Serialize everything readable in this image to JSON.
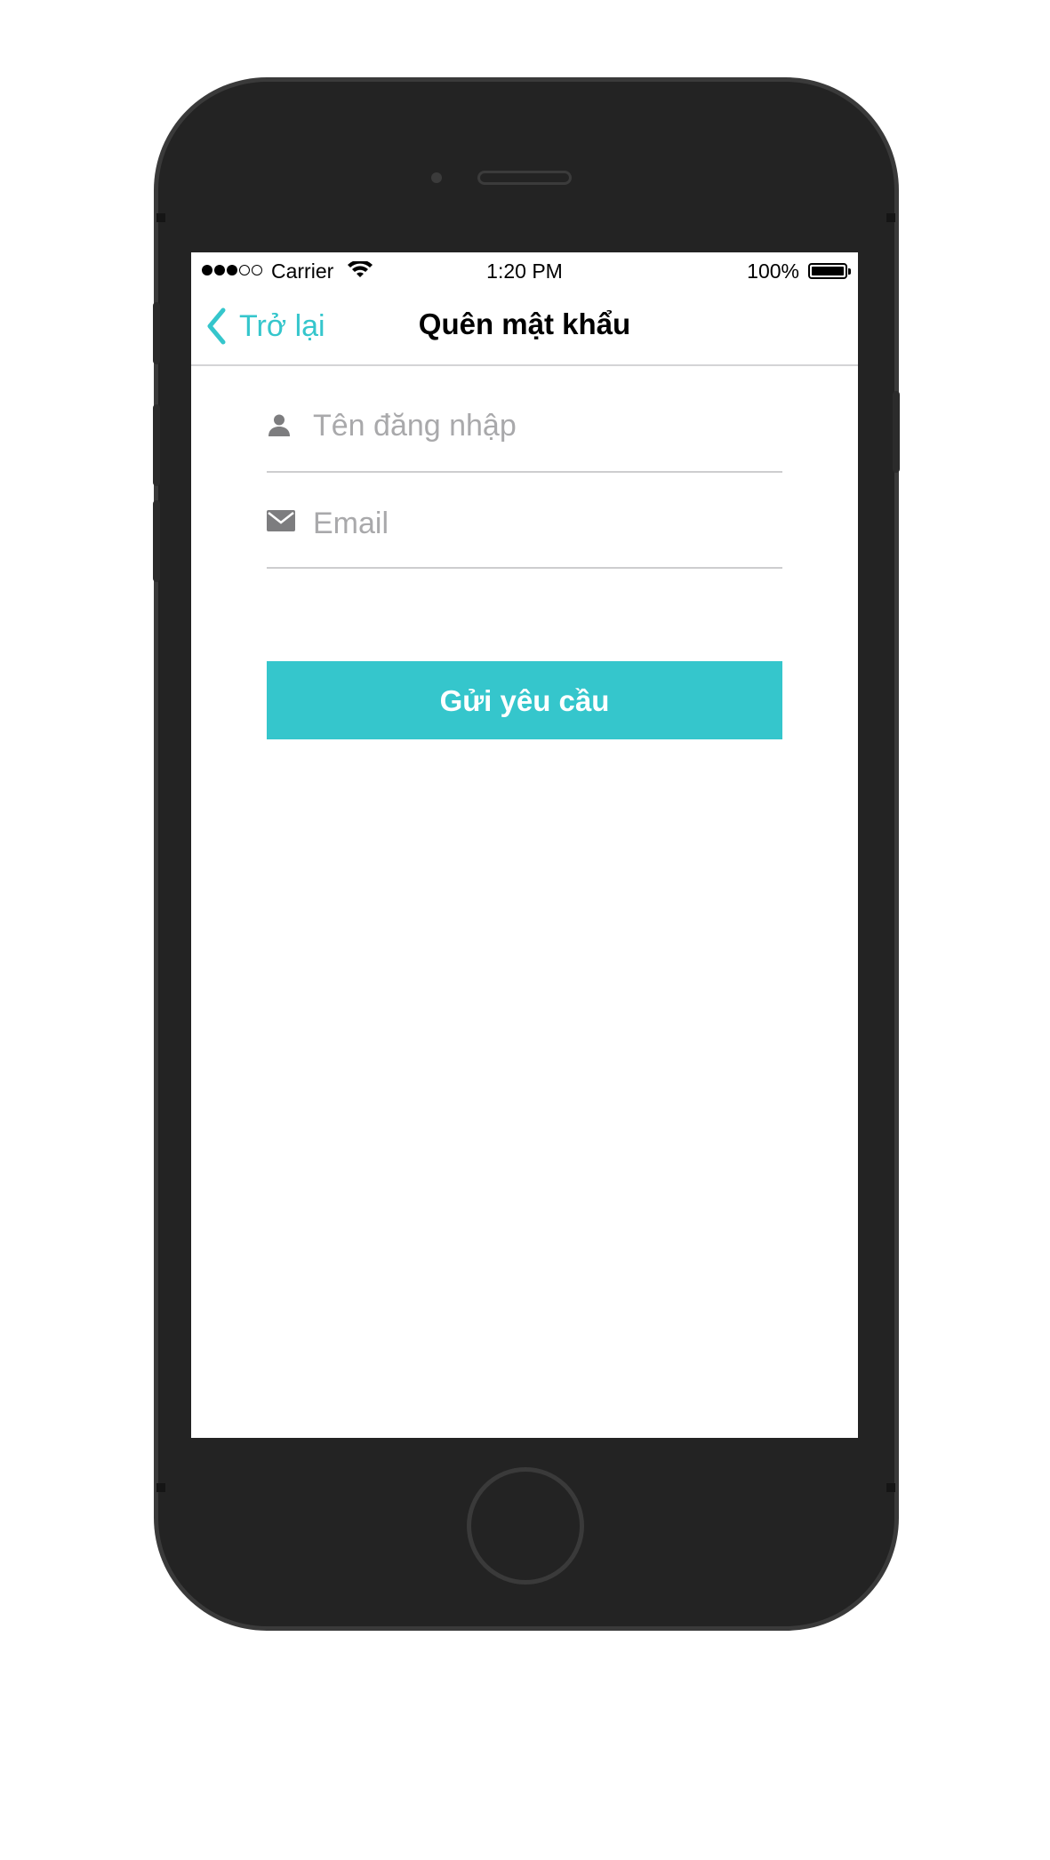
{
  "status_bar": {
    "carrier": "Carrier",
    "time": "1:20 PM",
    "battery_percent": "100%",
    "signal_bars_filled": 3,
    "signal_bars_total": 5
  },
  "nav": {
    "back_label": "Trở lại",
    "title": "Quên mật khẩu"
  },
  "form": {
    "username": {
      "placeholder": "Tên đăng nhập",
      "value": "",
      "icon": "user-icon"
    },
    "email": {
      "placeholder": "Email",
      "value": "",
      "icon": "mail-icon"
    },
    "submit_label": "Gửi yêu cầu"
  },
  "colors": {
    "accent": "#35c6cc",
    "device": "#232323",
    "placeholder": "#a9a9ab",
    "icon": "#7d7d7f"
  }
}
